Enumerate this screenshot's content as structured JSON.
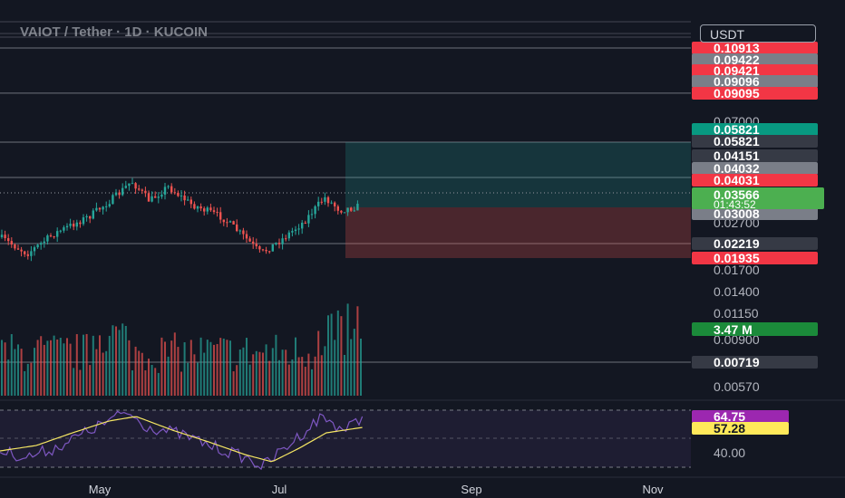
{
  "header": {
    "title": "VAIOT / Tether · 1D · KUCOIN",
    "quote_currency": "USDT"
  },
  "colors": {
    "background": "#131722",
    "up": "#26a69a",
    "down": "#ef5350",
    "rsi_line": "#7e57c2",
    "rsi_ma": "#f5e663",
    "label_red": "#f23645",
    "label_gray": "#7a7e88",
    "label_teal": "#089981",
    "label_dark": "#363a45",
    "label_green": "#4caf50",
    "label_volume": "#1b8a3a",
    "label_purple": "#9c27b0",
    "label_yellow": "#ffe95a"
  },
  "chart_data": [
    {
      "type": "candlestick",
      "pair": "VAIOT / Tether",
      "interval": "1D",
      "exchange": "KUCOIN",
      "x_ticks": [
        "May",
        "Jul",
        "Sep",
        "Nov"
      ],
      "y_range": [
        0.0052,
        0.11
      ],
      "y_ticks": [
        {
          "label": "0.07000",
          "value": 0.07
        },
        {
          "label": "0.02700",
          "value": 0.027
        },
        {
          "label": "0.01700",
          "value": 0.017
        },
        {
          "label": "0.01400",
          "value": 0.014
        },
        {
          "label": "0.01150",
          "value": 0.0115
        },
        {
          "label": "0.00900",
          "value": 0.009
        },
        {
          "label": "0.00570",
          "value": 0.0057
        }
      ],
      "price_labels": [
        {
          "text": "0.10913",
          "value": 0.10913,
          "color": "#f23645"
        },
        {
          "text": "0.09422",
          "value": 0.09422,
          "color": "#7a7e88"
        },
        {
          "text": "0.09421",
          "value": 0.09421,
          "color": "#f23645"
        },
        {
          "text": "0.09096",
          "value": 0.09096,
          "color": "#7a7e88"
        },
        {
          "text": "0.09095",
          "value": 0.09095,
          "color": "#f23645"
        },
        {
          "text": "0.05821",
          "value": 0.05821,
          "color": "#089981"
        },
        {
          "text": "0.05821",
          "value": 0.05821,
          "color": "#363a45"
        },
        {
          "text": "0.04151",
          "value": 0.04151,
          "color": "#363a45"
        },
        {
          "text": "0.04032",
          "value": 0.04032,
          "color": "#7a7e88"
        },
        {
          "text": "0.04031",
          "value": 0.04031,
          "color": "#f23645"
        },
        {
          "text": "0.03008",
          "value": 0.03008,
          "color": "#7a7e88"
        },
        {
          "text": "0.02219",
          "value": 0.02219,
          "color": "#363a45"
        },
        {
          "text": "0.01935",
          "value": 0.01935,
          "color": "#f23645"
        },
        {
          "text": "0.00719",
          "value": 0.00719,
          "color": "#363a45"
        }
      ],
      "last_price": {
        "text": "0.03566",
        "value": 0.03566,
        "countdown": "01:43:52",
        "color": "#4caf50"
      },
      "volume_label": {
        "text": "3.47 M",
        "color": "#1b8a3a"
      },
      "horizontal_levels": [
        0.10913,
        0.09096,
        0.05821,
        0.04151,
        0.02219,
        0.00719
      ],
      "position_tool": {
        "entry": 0.03566,
        "take_profit": 0.05821,
        "stop_loss": 0.01935
      },
      "rsi": {
        "value_label": "64.75",
        "ma_label": "57.28",
        "level_label": "40.00",
        "value_color": "#9c27b0",
        "ma_color": "#ffe95a"
      }
    }
  ]
}
